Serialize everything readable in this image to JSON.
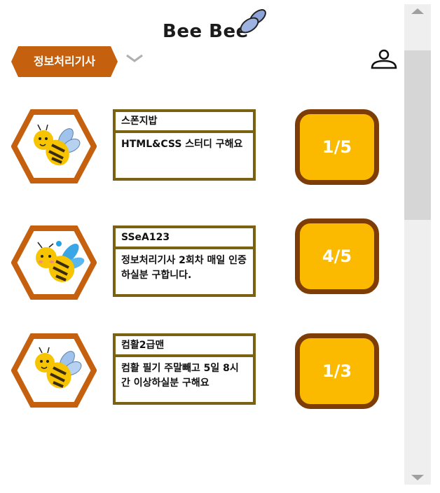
{
  "header": {
    "logo_text": "Bee Bee",
    "category_label": "정보처리기사"
  },
  "colors": {
    "accent_orange": "#c5600f",
    "box_border": "#7b6212",
    "count_fill": "#fbba00",
    "count_border": "#7e3c06"
  },
  "icons": {
    "dropdown": "chevron-down-icon",
    "profile": "user-icon",
    "logo": "bee-wings-icon"
  },
  "posts": [
    {
      "author": "스폰지밥",
      "description": "HTML&CSS 스터디 구해요",
      "members": "1/5"
    },
    {
      "author": "SSeA123",
      "description": "정보처리기사 2회차 매일 인증 하실분 구합니다.",
      "members": "4/5"
    },
    {
      "author": "컴활2급맨",
      "description": "컴활 필기 주말빼고 5일 8시간 이상하실분 구해요",
      "members": "1/3"
    }
  ]
}
